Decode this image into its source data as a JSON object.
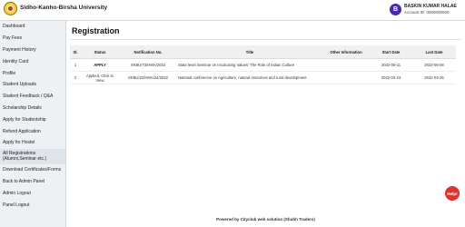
{
  "header": {
    "university": "Sidho-Kanho-Birsha University",
    "avatar_letter": "B",
    "user_name": "BASKIN KUMAR HALAE",
    "account": "Account ID: 0000000000"
  },
  "sidebar": {
    "items": [
      {
        "label": "Dashboard"
      },
      {
        "label": "Pay Fees"
      },
      {
        "label": "Payment History"
      },
      {
        "label": "Identity Card"
      },
      {
        "label": "Profile"
      },
      {
        "label": "Student Uploads"
      },
      {
        "label": "Student Feedback / Q&A"
      },
      {
        "label": "Scholarship Details"
      },
      {
        "label": "Apply for Studentship"
      },
      {
        "label": "Refund Application"
      },
      {
        "label": "Apply for Hostel"
      },
      {
        "label": "All Registrations (Alumni,Seminar etc.)"
      },
      {
        "label": "Download Certificates/Forms"
      },
      {
        "label": "Back to Admin Panel"
      },
      {
        "label": "Admin Logout"
      },
      {
        "label": "Panel Logout"
      }
    ]
  },
  "main": {
    "title": "Registration",
    "columns": [
      "Sl.",
      "Status",
      "Notification No.",
      "Title",
      "Other Information",
      "Start Date",
      "Last Date"
    ],
    "rows": [
      {
        "sl": "1",
        "status": "APPLY",
        "notification": "SKBU/73/HMA/2022",
        "title": "State level Seminar on Inculcating Values: The Role of Indian Culture",
        "other": "",
        "start": "2022-05-11",
        "last": "2022-06-08"
      },
      {
        "sl": "2",
        "status": "Applied, Click to View",
        "notification": "SKBU/22/HMA/24/2022",
        "title": "National conference on Agriculture, natural resources and rural development",
        "other": "",
        "start": "2022-03-23",
        "last": "2022-04-25"
      }
    ]
  },
  "help_label": "Help!",
  "footer": "Powered by Cityclub web solution (Shubh Traders)"
}
